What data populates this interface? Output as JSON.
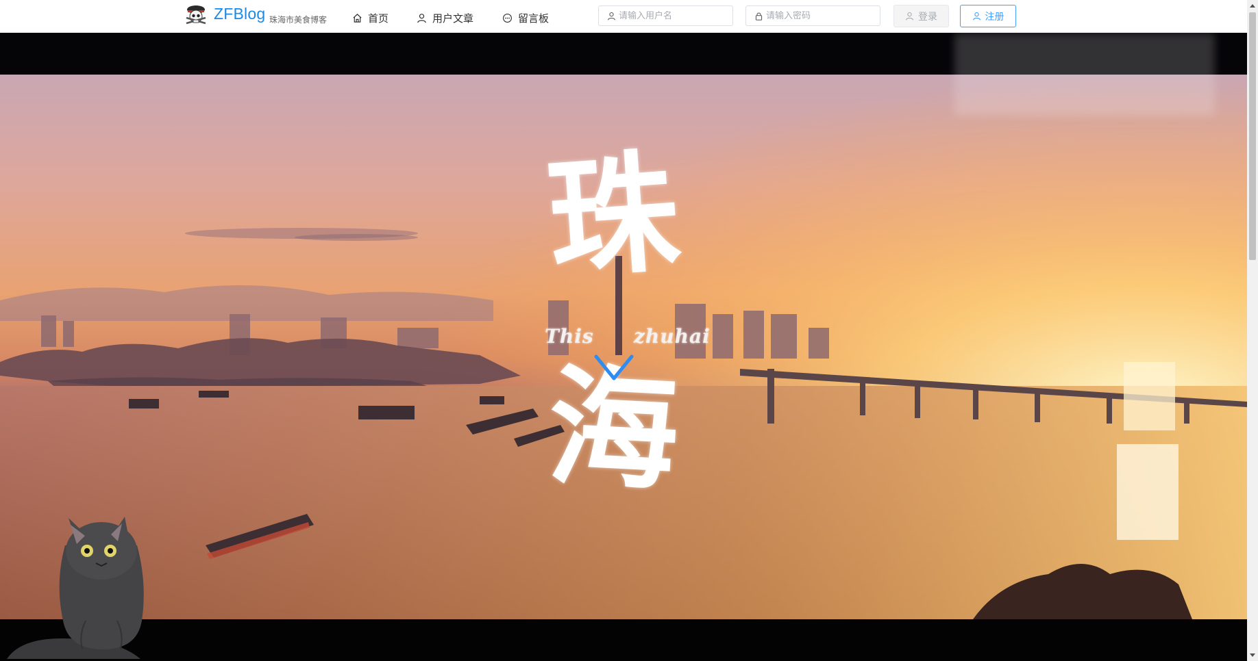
{
  "header": {
    "brand": "ZFBlog",
    "subtitle": "珠海市美食博客",
    "nav": [
      {
        "label": "首页",
        "icon": "home-icon"
      },
      {
        "label": "用户文章",
        "icon": "user-icon"
      },
      {
        "label": "留言板",
        "icon": "chat-icon"
      }
    ],
    "username_placeholder": "请输入用户名",
    "password_placeholder": "请输入密码",
    "login_label": "登录",
    "register_label": "注册"
  },
  "hero": {
    "char_top": "珠",
    "char_bottom": "海",
    "tagline_left": "This",
    "tagline_right": "zhuhai"
  },
  "colors": {
    "brand": "#1e88e5",
    "primary": "#409eff",
    "arrow": "#2f8cf0"
  }
}
